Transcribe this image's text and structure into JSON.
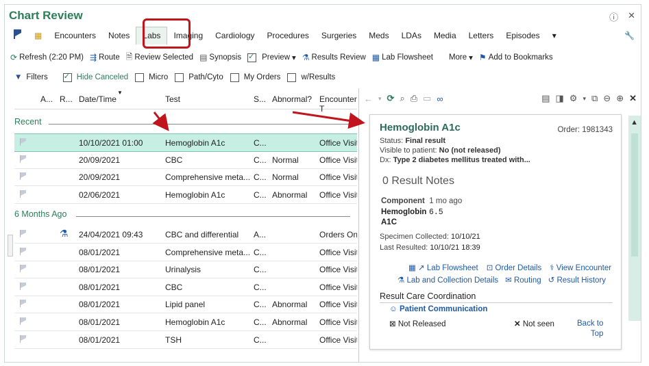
{
  "app": {
    "title": "Chart Review",
    "help_icon": "?",
    "close_icon": "×"
  },
  "tabs": [
    "Encounters",
    "Notes",
    "Labs",
    "Imaging",
    "Cardiology",
    "Procedures",
    "Surgeries",
    "Meds",
    "LDAs",
    "Media",
    "Letters",
    "Episodes"
  ],
  "active_tab": "Labs",
  "toolbar": {
    "refresh": "Refresh (2:20 PM)",
    "route": "Route",
    "review_selected": "Review Selected",
    "synopsis": "Synopsis",
    "preview": "Preview",
    "results_review": "Results Review",
    "lab_flowsheet": "Lab Flowsheet",
    "more": "More",
    "add_bookmarks": "Add to Bookmarks"
  },
  "filters": {
    "label": "Filters",
    "hide_canceled": "Hide Canceled",
    "micro": "Micro",
    "path_cyto": "Path/Cyto",
    "my_orders": "My Orders",
    "w_results": "w/Results"
  },
  "columns": {
    "a": "A...",
    "r": "R...",
    "date": "Date/Time",
    "test": "Test",
    "s": "S...",
    "abnormal": "Abnormal?",
    "encounter": "Encounter T"
  },
  "groups": {
    "recent": "Recent",
    "six_months": "6 Months Ago"
  },
  "rows_recent": [
    {
      "date": "10/10/2021 01:00",
      "test": "Hemoglobin A1c",
      "status": "C...",
      "abnormal": "",
      "encounter": "Office Visit"
    },
    {
      "date": "20/09/2021",
      "test": "CBC",
      "status": "C...",
      "abnormal": "Normal",
      "encounter": "Office Visit"
    },
    {
      "date": "20/09/2021",
      "test": "Comprehensive meta...",
      "status": "C...",
      "abnormal": "Normal",
      "encounter": "Office Visit"
    },
    {
      "date": "02/06/2021",
      "test": "Hemoglobin A1c",
      "status": "C...",
      "abnormal": "Abnormal",
      "encounter": "Office Visit"
    }
  ],
  "rows_six": [
    {
      "date": "24/04/2021 09:43",
      "test": "CBC and differential",
      "status": "A...",
      "abnormal": "",
      "encounter": "Orders Only"
    },
    {
      "date": "08/01/2021",
      "test": "Comprehensive meta...",
      "status": "C...",
      "abnormal": "",
      "encounter": "Office Visit"
    },
    {
      "date": "08/01/2021",
      "test": "Urinalysis",
      "status": "C...",
      "abnormal": "",
      "encounter": "Office Visit"
    },
    {
      "date": "08/01/2021",
      "test": "CBC",
      "status": "C...",
      "abnormal": "",
      "encounter": "Office Visit"
    },
    {
      "date": "08/01/2021",
      "test": "Lipid panel",
      "status": "C...",
      "abnormal": "Abnormal",
      "encounter": "Office Visit"
    },
    {
      "date": "08/01/2021",
      "test": "Hemoglobin A1c",
      "status": "C...",
      "abnormal": "Abnormal",
      "encounter": "Office Visit"
    },
    {
      "date": "08/01/2021",
      "test": "TSH",
      "status": "C...",
      "abnormal": "",
      "encounter": "Office Visit"
    }
  ],
  "detail": {
    "title": "Hemoglobin A1c",
    "order": "Order: 1981343",
    "status_label": "Status:",
    "status_value": "Final result",
    "visible_label": "Visible to patient:",
    "visible_value": "No (not released)",
    "dx_label": "Dx:",
    "dx_value": "Type 2 diabetes mellitus treated with...",
    "result_notes": "0  Result Notes",
    "component_label": "Component",
    "component_ago": "1 mo ago",
    "component_name_1": "Hemoglobin",
    "component_value": "6.5",
    "component_name_2": "A1C",
    "specimen_label": "Specimen Collected:",
    "specimen_value": "10/10/21",
    "last_label": "Last Resulted:",
    "last_value": "10/10/21 18:39",
    "link_lab_flowsheet": "Lab Flowsheet",
    "link_order_details": "Order Details",
    "link_view_encounter": "View Encounter",
    "link_lab_collection": "Lab and Collection Details",
    "link_routing": "Routing",
    "link_result_history": "Result History",
    "rcc_title": "Result Care Coordination",
    "patient_comm": "Patient Communication",
    "not_released": "Not Released",
    "not_seen": "Not seen",
    "back_to_top_1": "Back to",
    "back_to_top_2": "Top"
  },
  "colors": {
    "brand": "#2e7d5a",
    "highlight": "#c0151d",
    "selected": "#c6eee2",
    "link": "#1f5aa6"
  }
}
